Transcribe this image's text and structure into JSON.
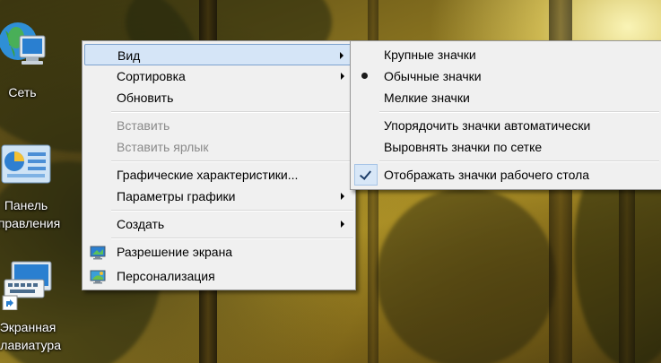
{
  "desktop": {
    "icons": [
      {
        "name": "network",
        "label": "Сеть"
      },
      {
        "name": "control-panel",
        "label_line1": "Панель",
        "label_line2": "управления"
      },
      {
        "name": "on-screen-keyboard",
        "label_line1": "Экранная",
        "label_line2": "клавиатура"
      }
    ]
  },
  "context_menu": {
    "items": [
      {
        "label": "Вид",
        "has_submenu": true,
        "highlighted": true
      },
      {
        "label": "Сортировка",
        "has_submenu": true
      },
      {
        "label": "Обновить"
      },
      {
        "label": "Вставить",
        "disabled": true
      },
      {
        "label": "Вставить ярлык",
        "disabled": true
      },
      {
        "label": "Графические характеристики..."
      },
      {
        "label": "Параметры графики",
        "has_submenu": true
      },
      {
        "label": "Создать",
        "has_submenu": true
      },
      {
        "label": "Разрешение экрана",
        "icon": "screen-resolution-icon"
      },
      {
        "label": "Персонализация",
        "icon": "personalization-icon"
      }
    ]
  },
  "view_submenu": {
    "items": [
      {
        "label": "Крупные значки"
      },
      {
        "label": "Обычные значки",
        "selected": true
      },
      {
        "label": "Мелкие значки"
      },
      {
        "label": "Упорядочить значки автоматически"
      },
      {
        "label": "Выровнять значки по сетке"
      },
      {
        "label": "Отображать значки рабочего стола",
        "checked": true
      }
    ]
  },
  "colors": {
    "menu_background": "#f0f0f0",
    "highlight": "#d5e5f7",
    "highlight_border": "#7da2ce",
    "disabled_text": "#8a8a8a"
  }
}
